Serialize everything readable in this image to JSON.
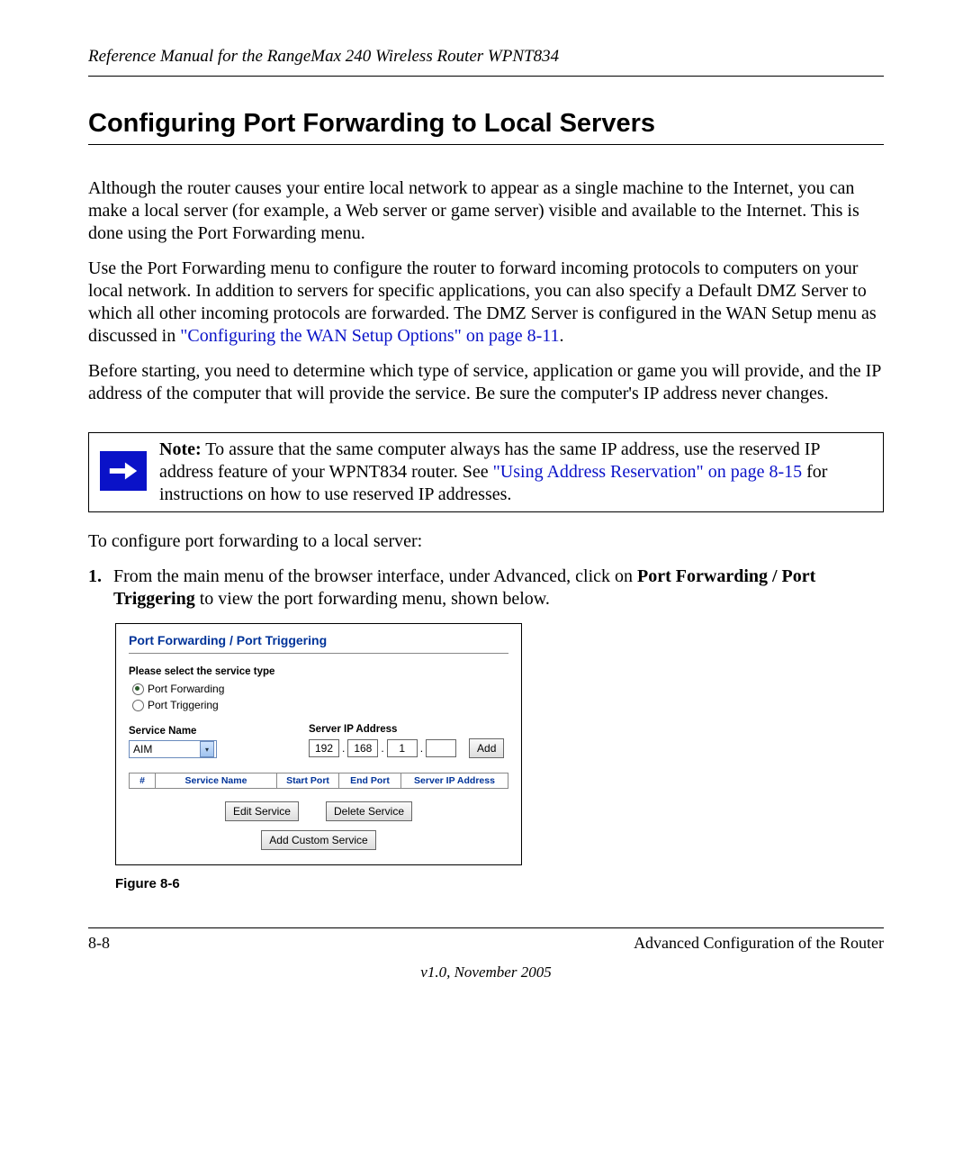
{
  "header": {
    "doc_title": "Reference Manual for the RangeMax 240 Wireless Router WPNT834"
  },
  "section": {
    "title": "Configuring Port Forwarding to Local Servers"
  },
  "para1": "Although the router causes your entire local network to appear as a single machine to the Internet, you can make a local server (for example, a Web server or game server) visible and available to the Internet. This is done using the Port Forwarding menu.",
  "para2a": "Use the Port Forwarding menu to configure the router to forward incoming protocols to computers on your local network. In addition to servers for specific applications, you can also specify a Default DMZ Server to which all other incoming protocols are forwarded. The DMZ Server is configured in the WAN Setup menu as discussed in ",
  "para2_link": "\"Configuring the WAN Setup Options\" on page 8-11",
  "para2b": ".",
  "para3": "Before starting, you need to determine which type of service, application or game you will provide, and the IP address of the computer that will provide the service. Be sure the computer's IP address never changes.",
  "note": {
    "label": "Note:",
    "text_a": " To assure that the same computer always has the same IP address, use the reserved IP address feature of your WPNT834 router. See ",
    "link": "\"Using Address Reservation\" on page 8-15",
    "text_b": " for instructions on how to use reserved IP addresses."
  },
  "lead_in": "To configure port forwarding to a local server:",
  "step1_num": "1.",
  "step1_a": "From the main menu of the browser interface, under Advanced, click on ",
  "step1_bold": "Port Forwarding / Port Triggering",
  "step1_b": " to view the port forwarding menu, shown below.",
  "ui": {
    "title": "Port Forwarding / Port Triggering",
    "select_label": "Please select the service type",
    "radio1": "Port Forwarding",
    "radio2": "Port Triggering",
    "svc_name_label": "Service Name",
    "svc_name_value": "AIM",
    "ip_label": "Server IP Address",
    "ip": {
      "o1": "192",
      "o2": "168",
      "o3": "1",
      "o4": ""
    },
    "add_btn": "Add",
    "table": {
      "h1": "#",
      "h2": "Service Name",
      "h3": "Start Port",
      "h4": "End Port",
      "h5": "Server IP Address"
    },
    "edit_btn": "Edit Service",
    "delete_btn": "Delete Service",
    "custom_btn": "Add Custom Service"
  },
  "figure_caption": "Figure 8-6",
  "footer": {
    "page": "8-8",
    "chapter": "Advanced Configuration of the Router",
    "version": "v1.0, November 2005"
  }
}
